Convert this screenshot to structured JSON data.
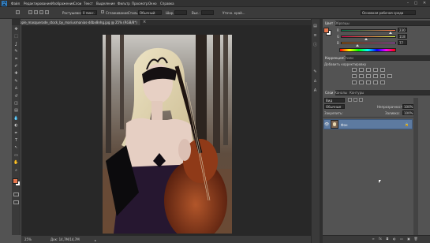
{
  "menubar": {
    "logo": "Ps",
    "items": [
      "Файл",
      "Редактирование",
      "Изображение",
      "Слои",
      "Текст",
      "Выделение",
      "Фильтр",
      "Просмотр",
      "Окно",
      "Справка"
    ],
    "window_controls": [
      "–",
      "▢",
      "✕"
    ]
  },
  "options_bar": {
    "feather_label": "Растушевка:",
    "feather_value": "0 пикс.",
    "antialias_label": "Сглаживание",
    "style_label": "Стиль:",
    "style_value": "Обычный",
    "width_label": "Шир.:",
    "height_label": "Выс.:",
    "refine_edge": "Уточн. край...",
    "workspace": "Основная рабочая среда"
  },
  "document": {
    "tab_title": "people_masquerade_stock_by_mariusmanias-d4bx8nhg.jpg @ 25% (RGB/8*)",
    "tab_close": "×",
    "zoom": "25%",
    "doc_info": "Док: 14,7M/14,7M"
  },
  "tools": [
    "move-icon",
    "marquee-icon",
    "lasso-icon",
    "quick-select-icon",
    "crop-icon",
    "eyedropper-icon",
    "healing-icon",
    "brush-icon",
    "stamp-icon",
    "history-brush-icon",
    "eraser-icon",
    "gradient-icon",
    "blur-icon",
    "dodge-icon",
    "pen-icon",
    "type-icon",
    "path-select-icon",
    "shape-icon",
    "hand-icon",
    "zoom-icon"
  ],
  "tool_glyphs": [
    "✥",
    "⬚",
    "ʆ",
    "✎",
    "⌗",
    "✐",
    "✚",
    "✎",
    "♙",
    "↺",
    "◫",
    "▤",
    "💧",
    "◐",
    "✒",
    "T",
    "↖",
    "▭",
    "✋",
    "⌕"
  ],
  "colors": {
    "foreground": "#e6764d",
    "background": "#ffffff",
    "accent": "#e6764d",
    "selected_layer": "#5d7aa0",
    "canvas": "#282828",
    "panel": "#535353"
  },
  "color_panel": {
    "tabs": [
      "Цвет",
      "Образцы"
    ],
    "channels": [
      {
        "label": "R",
        "value": "230",
        "level": 0.9
      },
      {
        "label": "G",
        "value": "118",
        "level": 0.46
      },
      {
        "label": "B",
        "value": "77",
        "level": 0.3
      }
    ]
  },
  "adjustments_panel": {
    "tabs": [
      "Коррекция",
      "Стили"
    ],
    "title": "Добавить корректировку",
    "icons": [
      "brightness-icon",
      "levels-icon",
      "curves-icon",
      "exposure-icon",
      "vibrance-icon",
      "hue-sat-icon",
      "color-balance-icon",
      "bw-icon",
      "photo-filter-icon",
      "channel-mixer-icon",
      "lookup-icon",
      "invert-icon",
      "posterize-icon",
      "threshold-icon",
      "gradient-map-icon",
      "selective-color-icon"
    ]
  },
  "layers_panel": {
    "tabs": [
      "Слои",
      "Каналы",
      "Контуры"
    ],
    "kind_label": "Вид",
    "blend_mode": "Обычные",
    "opacity_label": "Непрозрачность:",
    "opacity_value": "100%",
    "lock_label": "Закрепить:",
    "fill_label": "Заливка:",
    "fill_value": "100%",
    "layers": [
      {
        "name": "Фон",
        "locked": true,
        "visible": true
      }
    ]
  }
}
